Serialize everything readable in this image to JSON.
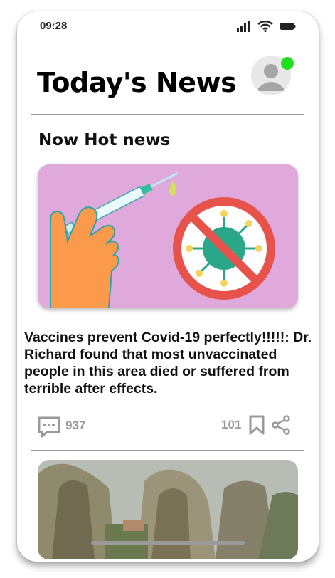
{
  "status": {
    "time": "09:28"
  },
  "header": {
    "title": "Today's News"
  },
  "section": {
    "title": "Now Hot news"
  },
  "article": {
    "headline": "Vaccines prevent Covid-19 perfectly!!!!!: Dr. Richard found that most unvaccinated people in this area died or suffered from terrible after effects.",
    "comments": "937",
    "saves": "101"
  },
  "colors": {
    "online": "#1fe01f",
    "hero_bg": "#dfa9dc",
    "stat_gray": "#999999"
  },
  "icons": {
    "signal": "signal-icon",
    "wifi": "wifi-icon",
    "battery": "battery-icon",
    "avatar": "user-avatar-icon",
    "comment": "comment-icon",
    "bookmark": "bookmark-icon",
    "share": "share-icon"
  }
}
